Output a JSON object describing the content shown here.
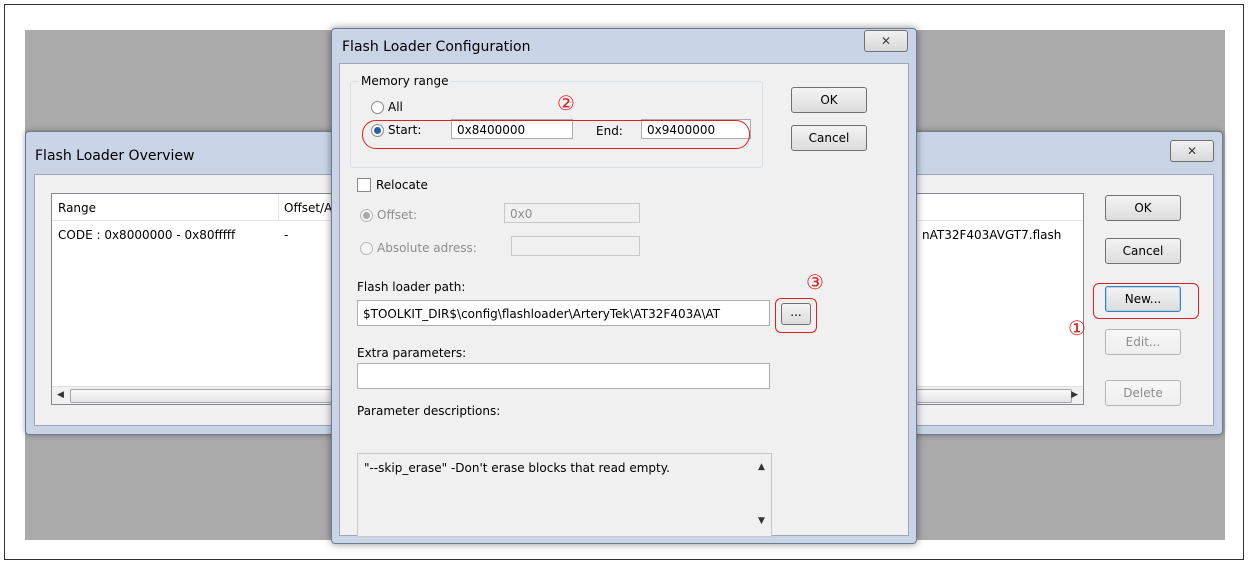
{
  "overview": {
    "title": "Flash Loader Overview",
    "close_glyph": "✕",
    "columns": [
      "Range",
      "Offset/A"
    ],
    "rows": [
      {
        "range": "CODE : 0x8000000 - 0x80fffff",
        "offset": "-",
        "loader": "nAT32F403AVGT7.flash"
      }
    ],
    "buttons": {
      "ok": "OK",
      "cancel": "Cancel",
      "new": "New...",
      "edit": "Edit...",
      "delete": "Delete"
    }
  },
  "config": {
    "title": "Flash Loader Configuration",
    "close_glyph": "✕",
    "memory_range": {
      "legend": "Memory range",
      "all_label": "All",
      "start_label": "Start:",
      "start_value": "0x8400000",
      "end_label": "End:",
      "end_value": "0x9400000",
      "selected": "start"
    },
    "relocate": {
      "label": "Relocate",
      "checked": false,
      "offset_label": "Offset:",
      "offset_value": "0x0",
      "absolute_label": "Absolute adress:",
      "absolute_value": ""
    },
    "loader_path": {
      "label": "Flash loader path:",
      "value": "$TOOLKIT_DIR$\\config\\flashloader\\ArteryTek\\AT32F403A\\AT",
      "browse_label": "..."
    },
    "extra": {
      "label": "Extra parameters:",
      "value": ""
    },
    "descriptions": {
      "label": "Parameter descriptions:",
      "text": "\"--skip_erase\" -Don't erase blocks that read empty."
    },
    "buttons": {
      "ok": "OK",
      "cancel": "Cancel"
    }
  },
  "annotations": {
    "one": "①",
    "two": "②",
    "three": "③",
    "color": "#e02020"
  }
}
